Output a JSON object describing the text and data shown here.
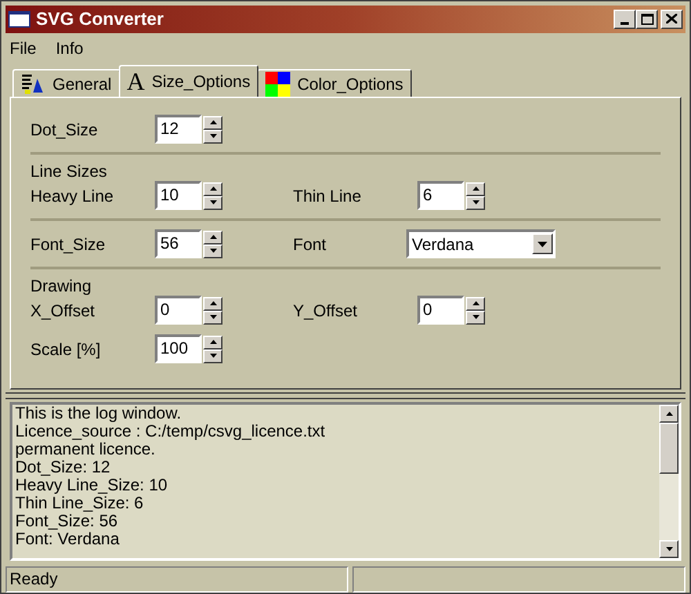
{
  "window": {
    "title": "SVG Converter"
  },
  "menu": [
    "File",
    "Info"
  ],
  "tabs": [
    {
      "label": "General",
      "selected": false
    },
    {
      "label": "Size_Options",
      "glyph": "A",
      "selected": true
    },
    {
      "label": "Color_Options",
      "selected": false
    }
  ],
  "sections": [
    {
      "rows": [
        [
          {
            "label": "Dot_Size",
            "kind": "spin",
            "value": "12"
          }
        ]
      ]
    },
    {
      "heading": "Line Sizes",
      "rows": [
        [
          {
            "label": "Heavy Line",
            "kind": "spin",
            "value": "10"
          },
          {
            "label": "Thin Line",
            "kind": "spin",
            "value": "6"
          }
        ]
      ]
    },
    {
      "rows": [
        [
          {
            "label": "Font_Size",
            "kind": "spin",
            "value": "56"
          },
          {
            "label": "Font",
            "kind": "dropdown",
            "value": "Verdana"
          }
        ]
      ]
    },
    {
      "heading": "Drawing",
      "rows": [
        [
          {
            "label": "X_Offset",
            "kind": "spin",
            "value": "0"
          },
          {
            "label": "Y_Offset",
            "kind": "spin",
            "value": "0"
          }
        ],
        [
          {
            "label": "Scale [%]",
            "kind": "spin",
            "value": "100"
          }
        ]
      ]
    }
  ],
  "log": [
    "This is the log window.",
    "Licence_source : C:/temp/csvg_licence.txt",
    "permanent licence.",
    "Dot_Size: 12",
    "Heavy Line_Size: 10",
    "Thin Line_Size: 6",
    "Font_Size: 56",
    "Font: Verdana"
  ],
  "status_bar": [
    "Ready"
  ]
}
